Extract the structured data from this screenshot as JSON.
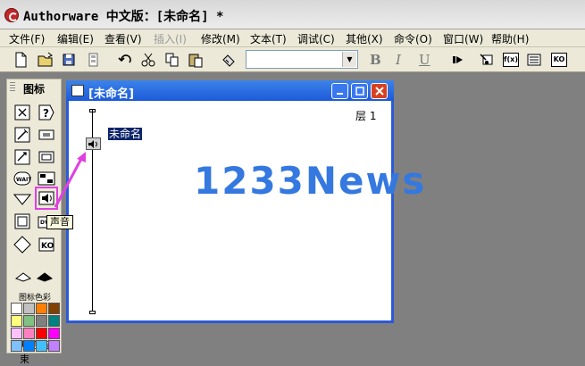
{
  "app": {
    "title": "Authorware 中文版：[未命名] *"
  },
  "menubar": {
    "items": [
      {
        "label": "文件(F)",
        "enabled": true
      },
      {
        "label": "编辑(E)",
        "enabled": true
      },
      {
        "label": "查看(V)",
        "enabled": true
      },
      {
        "label": "插入(I)",
        "enabled": false
      },
      {
        "label": "修改(M)",
        "enabled": true
      },
      {
        "label": "文本(T)",
        "enabled": true
      },
      {
        "label": "调试(C)",
        "enabled": true
      },
      {
        "label": "其他(X)",
        "enabled": true
      },
      {
        "label": "命令(O)",
        "enabled": true
      },
      {
        "label": "窗口(W)",
        "enabled": true
      },
      {
        "label": "帮助(H)",
        "enabled": true
      }
    ]
  },
  "toolbar": {
    "buttons": [
      "new-icon",
      "open-icon",
      "save-all-icon",
      "import-icon",
      "undo-icon",
      "cut-icon",
      "copy-icon",
      "paste-icon",
      "find-icon"
    ],
    "font_value": "",
    "bold_label": "B",
    "italic_label": "I",
    "underline_label": "U",
    "run_buttons": [
      "restart-icon",
      "control-panel-icon",
      "functions-icon",
      "variables-icon",
      "knowledge-objects-icon"
    ],
    "functions_label": "f(x)",
    "ko_label": "KO"
  },
  "palette": {
    "title": "图标",
    "tooltip": "声音",
    "start_end_label": "开始 结束",
    "colors_label": "图标色彩",
    "icons": [
      "display-icon",
      "motion-icon",
      "erase-icon",
      "wait-icon",
      "navigate-icon",
      "framework-icon",
      "decision-icon",
      "interaction-icon",
      "calculation-icon",
      "map-icon",
      "digital-movie-icon",
      "sound-icon",
      "video-icon",
      "knowledge-object-icon"
    ],
    "wait_label": "WAIT",
    "colors": [
      "#ffffff",
      "#c0c0c0",
      "#ff8000",
      "#804000",
      "#ffff80",
      "#80c080",
      "#808080",
      "#008080",
      "#ffc0ff",
      "#ff80c0",
      "#ff0000",
      "#ff00ff",
      "#80c0ff",
      "#0080ff",
      "#40c0ff",
      "#c080ff"
    ]
  },
  "design_window": {
    "title": "[未命名]",
    "layer_label": "层 1",
    "flow_icon_label": "未命名",
    "watermark": "1233News"
  }
}
